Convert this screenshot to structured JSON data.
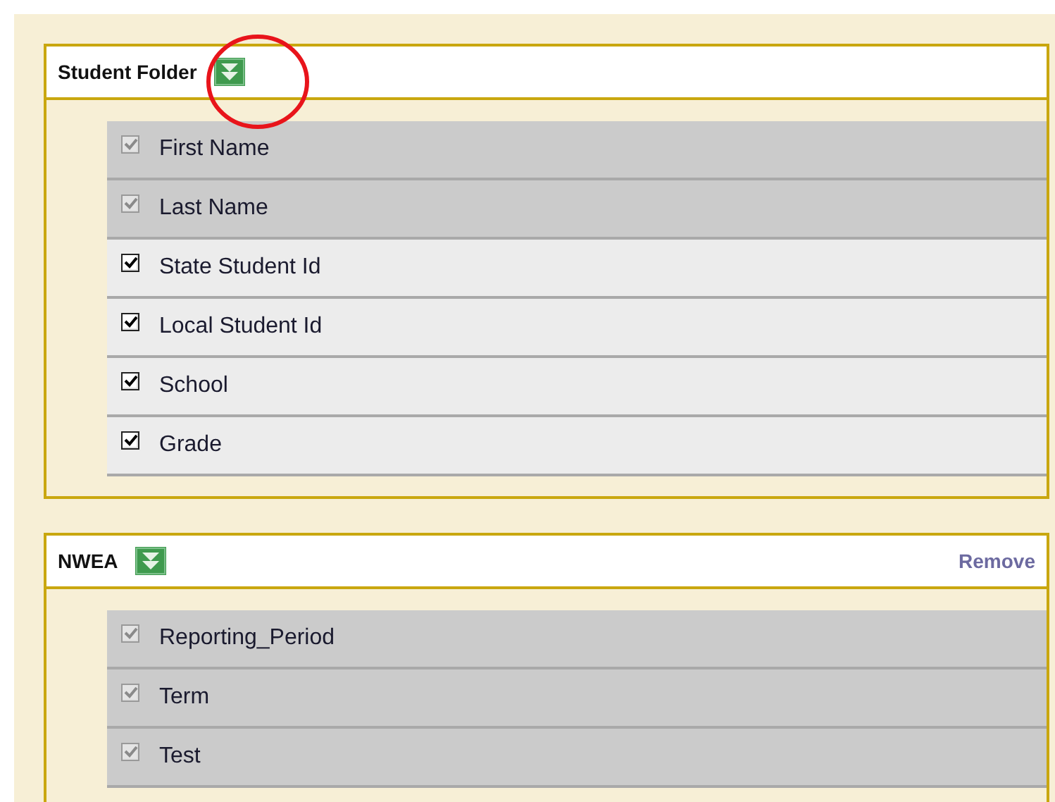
{
  "panels": [
    {
      "title": "Student Folder",
      "highlighted": true,
      "rows": [
        {
          "label": "First Name",
          "checked": true,
          "disabled": true
        },
        {
          "label": "Last Name",
          "checked": true,
          "disabled": true
        },
        {
          "label": "State Student Id",
          "checked": true,
          "disabled": false
        },
        {
          "label": "Local Student Id",
          "checked": true,
          "disabled": false
        },
        {
          "label": "School",
          "checked": true,
          "disabled": false
        },
        {
          "label": "Grade",
          "checked": true,
          "disabled": false
        }
      ]
    },
    {
      "title": "NWEA",
      "remove_label": "Remove",
      "highlighted": false,
      "rows": [
        {
          "label": "Reporting_Period",
          "checked": true,
          "disabled": true
        },
        {
          "label": "Term",
          "checked": true,
          "disabled": true
        },
        {
          "label": "Test",
          "checked": true,
          "disabled": true
        }
      ]
    }
  ]
}
